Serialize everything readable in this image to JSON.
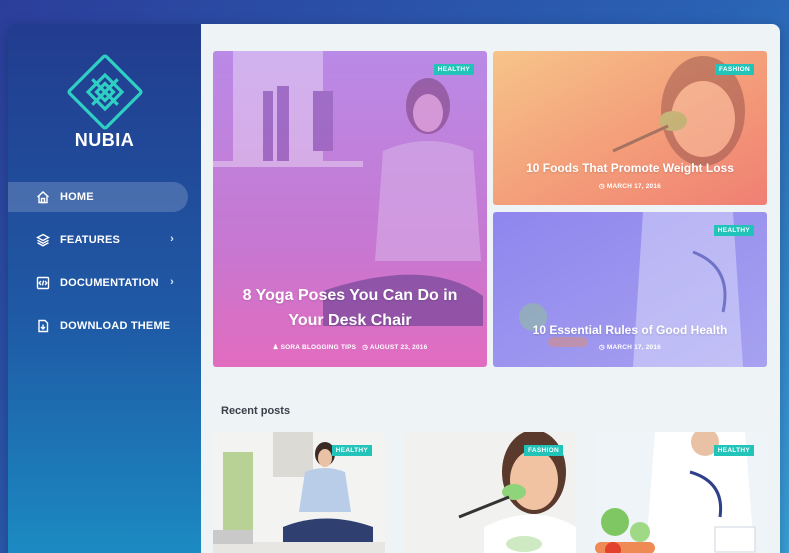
{
  "brand": {
    "name": "NUBIA",
    "icon": "knot-logo-icon",
    "accent": "#2fd0c4"
  },
  "nav": {
    "items": [
      {
        "label": "HOME",
        "icon": "home-icon",
        "has_submenu": false,
        "active": true
      },
      {
        "label": "FEATURES",
        "icon": "layers-icon",
        "has_submenu": true,
        "active": false
      },
      {
        "label": "DOCUMENTATION",
        "icon": "code-file-icon",
        "has_submenu": true,
        "active": false
      },
      {
        "label": "DOWNLOAD THEME",
        "icon": "download-file-icon",
        "has_submenu": false,
        "active": false
      }
    ]
  },
  "featured": {
    "main": {
      "tag": "HEALTHY",
      "title_line1": "8 Yoga Poses You Can Do in",
      "title_line2": "Your Desk Chair",
      "author": "SORA BLOGGING TIPS",
      "date": "AUGUST 23, 2016"
    },
    "top_right": {
      "tag": "FASHION",
      "title": "10 Foods That Promote Weight Loss",
      "date": "MARCH 17, 2016"
    },
    "bottom_right": {
      "tag": "HEALTHY",
      "title": "10 Essential Rules of Good Health",
      "date": "MARCH 17, 2016"
    }
  },
  "recent": {
    "title": "Recent posts",
    "posts": [
      {
        "tag": "HEALTHY"
      },
      {
        "tag": "FASHION"
      },
      {
        "tag": "HEALTHY"
      }
    ]
  },
  "colors": {
    "tag_bg": "#22c3b9",
    "overlay_purple": "#c86fd6",
    "overlay_orange": "#f28e6e",
    "overlay_blue": "#7f86ef"
  }
}
